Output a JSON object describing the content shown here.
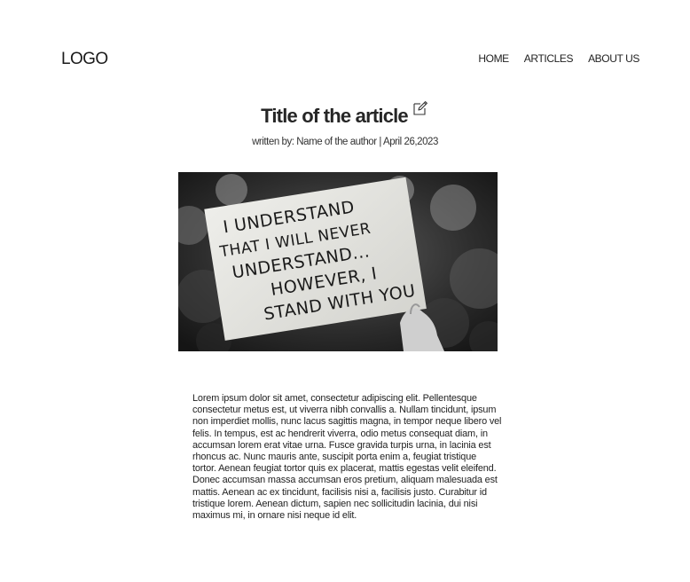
{
  "header": {
    "logo": "LOGO",
    "nav": [
      "HOME",
      "ARTICLES",
      "ABOUT US"
    ]
  },
  "article": {
    "title": "Title of the article",
    "byline": "written by: Name of the author | April 26,2023",
    "image_sign_lines": [
      "I UNDERSTAND",
      "THAT I WILL NEVER",
      "UNDERSTAND...",
      "HOWEVER, I",
      "STAND WITH YOU"
    ],
    "body": "Lorem ipsum dolor sit amet, consectetur adipiscing elit. Pellentesque consectetur metus est, ut viverra nibh convallis a. Nullam tincidunt, ipsum non imperdiet mollis, nunc lacus sagittis magna, in tempor neque libero vel felis. In tempus, est ac hendrerit viverra, odio metus consequat diam, in accumsan lorem erat vitae urna. Fusce gravida turpis urna, in lacinia est rhoncus ac. Nunc mauris ante, suscipit porta enim a, feugiat tristique tortor. Aenean feugiat tortor quis ex placerat, mattis egestas velit eleifend. Donec accumsan massa accumsan eros pretium, aliquam malesuada est mattis. Aenean ac ex tincidunt, facilisis nisi a, facilisis justo. Curabitur id tristique lorem. Aenean dictum, sapien nec sollicitudin lacinia, dui nisi maximus mi, in ornare nisi neque id elit."
  },
  "icons": {
    "edit": "edit-icon"
  }
}
